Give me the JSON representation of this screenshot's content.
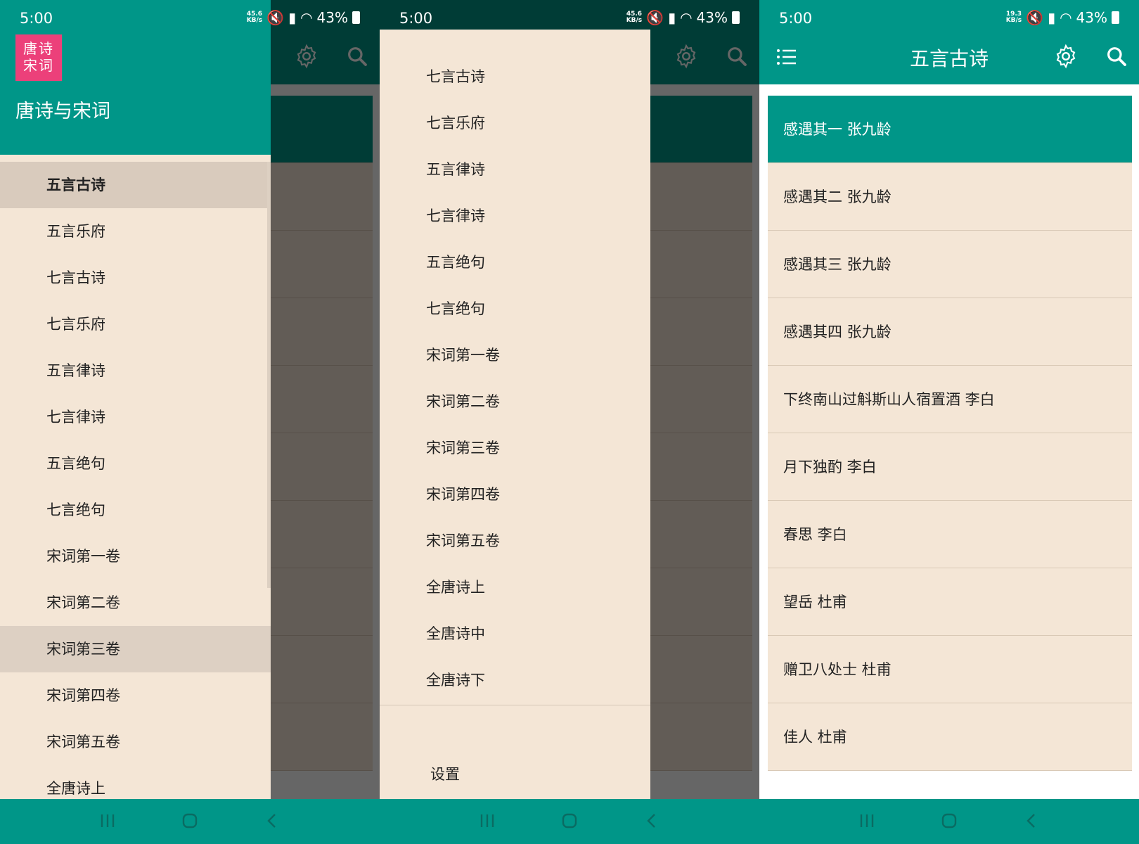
{
  "status": {
    "time": "5:00",
    "speed_left": "45.6\nKB/s",
    "speed_right": "19.3\nKB/s",
    "battery": "43%"
  },
  "app": {
    "logo_text": "唐诗\n宋词",
    "name": "唐诗与宋词",
    "page_title": "五言古诗"
  },
  "drawer": {
    "items": [
      "五言古诗",
      "五言乐府",
      "七言古诗",
      "七言乐府",
      "五言律诗",
      "七言律诗",
      "五言绝句",
      "七言绝句",
      "宋词第一卷",
      "宋词第二卷",
      "宋词第三卷",
      "宋词第四卷",
      "宋词第五卷",
      "全唐诗上",
      "全唐诗中",
      "全唐诗下"
    ],
    "settings_label": "设置"
  },
  "poems": [
    "感遇其一 张九龄",
    "感遇其二 张九龄",
    "感遇其三 张九龄",
    "感遇其四 张九龄",
    "下终南山过斛斯山人宿置酒 李白",
    "月下独酌 李白",
    "春思 李白",
    "望岳 杜甫",
    "赠卫八处士 杜甫",
    "佳人 杜甫"
  ],
  "colors": {
    "primary": "#009688",
    "surface": "#f4e6d6",
    "accent": "#ec407a"
  }
}
